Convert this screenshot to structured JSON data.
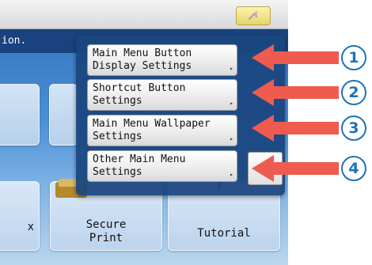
{
  "header": {
    "subtitle": "ion.",
    "top_icon": "wrench-icon"
  },
  "tiles": [
    {
      "label": "x",
      "icon": "tile-icon"
    },
    {
      "label_line1": "Secure",
      "label_line2": "Print"
    },
    {
      "label": "Tutorial"
    }
  ],
  "menu": {
    "items": [
      {
        "line1": "Main Menu Button",
        "line2": "Display Settings",
        "caret": "▸"
      },
      {
        "line1": "Shortcut Button",
        "line2": "Settings",
        "caret": "▸"
      },
      {
        "line1": "Main Menu Wallpaper",
        "line2": "Settings",
        "caret": "▸"
      },
      {
        "line1": "Other Main Menu",
        "line2": "Settings",
        "caret": "▸"
      }
    ]
  },
  "callouts": {
    "arrow_color": "#ef5b4f",
    "badge_color": "#1d73b8",
    "badges": [
      "1",
      "2",
      "3",
      "4"
    ]
  }
}
